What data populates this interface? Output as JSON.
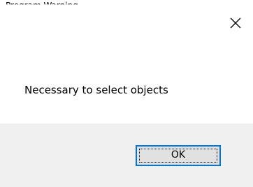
{
  "dialog": {
    "title": "Program Warning",
    "message": "Necessary to select objects",
    "ok_label": "OK"
  },
  "icons": {
    "close": "close-icon"
  },
  "colors": {
    "content_background": "#ffffff",
    "footer_background": "#f0f0f0",
    "button_face": "#e1e1e1",
    "button_focus_border": "#0078d7"
  }
}
